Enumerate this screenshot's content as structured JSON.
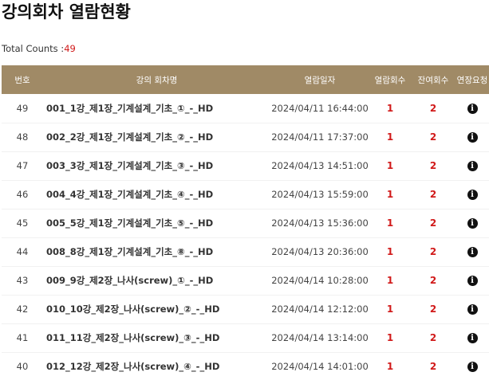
{
  "page": {
    "title": "강의회차 열람현황",
    "total_label": "Total Counts :",
    "total_count": "49"
  },
  "table": {
    "headers": {
      "number": "번호",
      "session_name": "강의 회차명",
      "view_date": "열람일자",
      "view_count": "열람회수",
      "remaining_count": "잔여회수",
      "extension_request": "연장요청"
    },
    "rows": [
      {
        "no": "49",
        "name": "001_1강_제1장_기계설계_기초_①_-_HD",
        "date": "2024/04/11 16:44:00",
        "views": "1",
        "remaining": "2",
        "extension_icon": "info-circle-icon"
      },
      {
        "no": "48",
        "name": "002_2강_제1장_기계설계_기초_②_-_HD",
        "date": "2024/04/11 17:37:00",
        "views": "1",
        "remaining": "2",
        "extension_icon": "info-circle-icon"
      },
      {
        "no": "47",
        "name": "003_3강_제1장_기계설계_기초_③_-_HD",
        "date": "2024/04/13 14:51:00",
        "views": "1",
        "remaining": "2",
        "extension_icon": "info-circle-icon"
      },
      {
        "no": "46",
        "name": "004_4강_제1장_기계설계_기초_④_-_HD",
        "date": "2024/04/13 15:59:00",
        "views": "1",
        "remaining": "2",
        "extension_icon": "info-circle-icon"
      },
      {
        "no": "45",
        "name": "005_5강_제1장_기계설계_기초_⑤_-_HD",
        "date": "2024/04/13 15:36:00",
        "views": "1",
        "remaining": "2",
        "extension_icon": "info-circle-icon"
      },
      {
        "no": "44",
        "name": "008_8강_제1장_기계설계_기초_⑧_-_HD",
        "date": "2024/04/13 20:36:00",
        "views": "1",
        "remaining": "2",
        "extension_icon": "info-circle-icon"
      },
      {
        "no": "43",
        "name": "009_9강_제2장_나사(screw)_①_-_HD",
        "date": "2024/04/14 10:28:00",
        "views": "1",
        "remaining": "2",
        "extension_icon": "info-circle-icon"
      },
      {
        "no": "42",
        "name": "010_10강_제2장_나사(screw)_②_-_HD",
        "date": "2024/04/14 12:12:00",
        "views": "1",
        "remaining": "2",
        "extension_icon": "info-circle-icon"
      },
      {
        "no": "41",
        "name": "011_11강_제2장_나사(screw)_③_-_HD",
        "date": "2024/04/14 13:14:00",
        "views": "1",
        "remaining": "2",
        "extension_icon": "info-circle-icon"
      },
      {
        "no": "40",
        "name": "012_12강_제2장_나사(screw)_④_-_HD",
        "date": "2024/04/14 14:01:00",
        "views": "1",
        "remaining": "2",
        "extension_icon": "info-circle-icon"
      }
    ]
  },
  "colors": {
    "header_bg": "#a08a66",
    "count_red": "#d11a1a"
  }
}
